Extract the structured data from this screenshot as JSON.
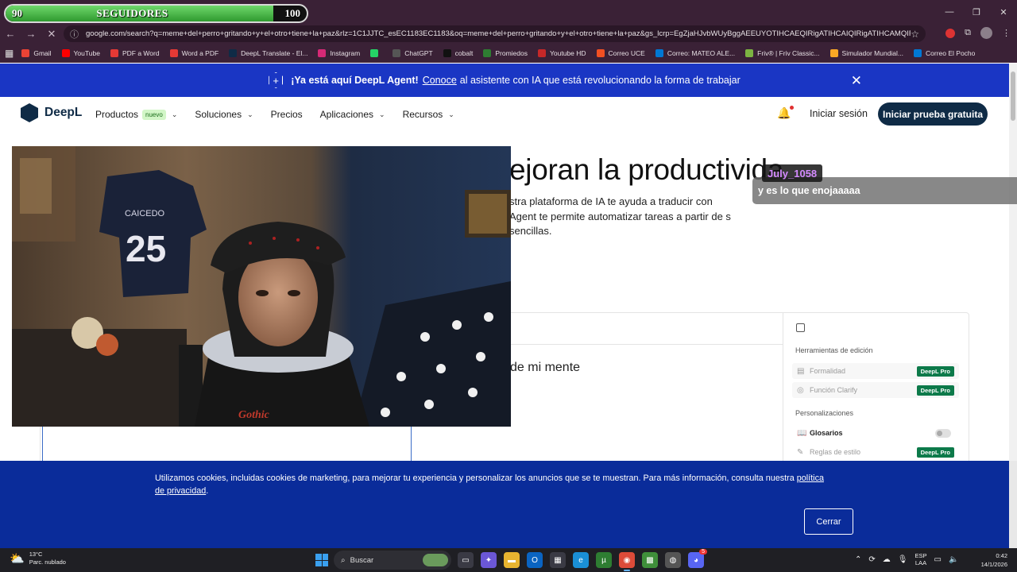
{
  "overlay": {
    "followers": {
      "label": "SEGUIDORES",
      "min": "90",
      "max": "100",
      "progress_fraction": 0.89
    }
  },
  "browser": {
    "url": "google.com/search?q=meme+del+perro+gritando+y+el+otro+tiene+la+paz&rlz=1C1JJTC_esEC1183EC1183&oq=meme+del+perro+gritando+y+el+otro+tiene+la+paz&gs_lcrp=EgZjaHJvbWUyBggAEEUYOTIHCAEQIRigATIHCAIQIRigATIHCAMQIRi...",
    "bookmarks": [
      {
        "label": "Gmail",
        "color": "#ea4335",
        "icon": "gmail-icon"
      },
      {
        "label": "YouTube",
        "color": "#ff0000",
        "icon": "youtube-icon"
      },
      {
        "label": "PDF a Word",
        "color": "#e53935",
        "icon": "pdf-icon"
      },
      {
        "label": "Word a PDF",
        "color": "#e53935",
        "icon": "pdf-icon"
      },
      {
        "label": "DeepL Translate - El...",
        "color": "#0f2b46",
        "icon": "deepl-icon"
      },
      {
        "label": "Instagram",
        "color": "#d62976",
        "icon": "instagram-icon"
      },
      {
        "label": "",
        "color": "#25d366",
        "icon": "whatsapp-icon"
      },
      {
        "label": "ChatGPT",
        "color": "#555555",
        "icon": "chatgpt-icon"
      },
      {
        "label": "cobalt",
        "color": "#111111",
        "icon": "cobalt-icon"
      },
      {
        "label": "Promiedos",
        "color": "#2e7d32",
        "icon": "promiedos-icon"
      },
      {
        "label": "Youtube HD",
        "color": "#c62828",
        "icon": "youtube-hd-icon"
      },
      {
        "label": "Correo UCE",
        "color": "#f25022",
        "icon": "microsoft-icon"
      },
      {
        "label": "Correo: MATEO ALE...",
        "color": "#0078d4",
        "icon": "outlook-icon"
      },
      {
        "label": "Friv® | Friv Classic...",
        "color": "#7cb342",
        "icon": "friv-icon"
      },
      {
        "label": "Simulador Mundial...",
        "color": "#f9a825",
        "icon": "simulator-icon"
      },
      {
        "label": "Correo El Pocho",
        "color": "#0078d4",
        "icon": "outlook-icon"
      }
    ]
  },
  "deepl": {
    "banner": {
      "bold": "¡Ya está aquí DeepL Agent!",
      "link": "Conoce",
      "rest": "al asistente con IA que está revolucionando la forma de trabajar"
    },
    "logo": "DeepL",
    "nav": [
      {
        "label": "Productos",
        "badge": "nuevo",
        "chevron": true
      },
      {
        "label": "Soluciones",
        "badge": "",
        "chevron": true
      },
      {
        "label": "Precios",
        "badge": "",
        "chevron": false
      },
      {
        "label": "Aplicaciones",
        "badge": "",
        "chevron": true
      },
      {
        "label": "Recursos",
        "badge": "",
        "chevron": true
      }
    ],
    "login": "Iniciar sesión",
    "cta": "Iniciar prueba gratuita",
    "hero_title": "ejoran la productivida",
    "hero_desc": "stra plataforma de IA te ayuda a traducir con Agent te permite automatizar tareas a partir de s sencillas.",
    "translator_text": "de mi mente",
    "side": {
      "editing_heading": "Herramientas de edición",
      "formality": "Formalidad",
      "clarify": "Función Clarify",
      "personal_heading": "Personalizaciones",
      "glossaries": "Glosarios",
      "style_rules": "Reglas de estilo",
      "pro_badge": "DeepL Pro"
    },
    "cookie": {
      "text": "Utilizamos cookies, incluidas cookies de marketing, para mejorar tu experiencia y personalizar los anuncios que se te muestran. Para más información, consulta nuestra",
      "link": "política de privacidad",
      "close": "Cerrar"
    }
  },
  "chat": {
    "user": "July_1058",
    "message": "y es lo que enojaaaaa"
  },
  "taskbar": {
    "temp": "13°C",
    "weather": "Parc. nublado",
    "search": "Buscar",
    "lang_1": "ESP",
    "lang_2": "LAA",
    "time": "0:42",
    "date": "14/1/2026",
    "discord_badge": "5"
  }
}
